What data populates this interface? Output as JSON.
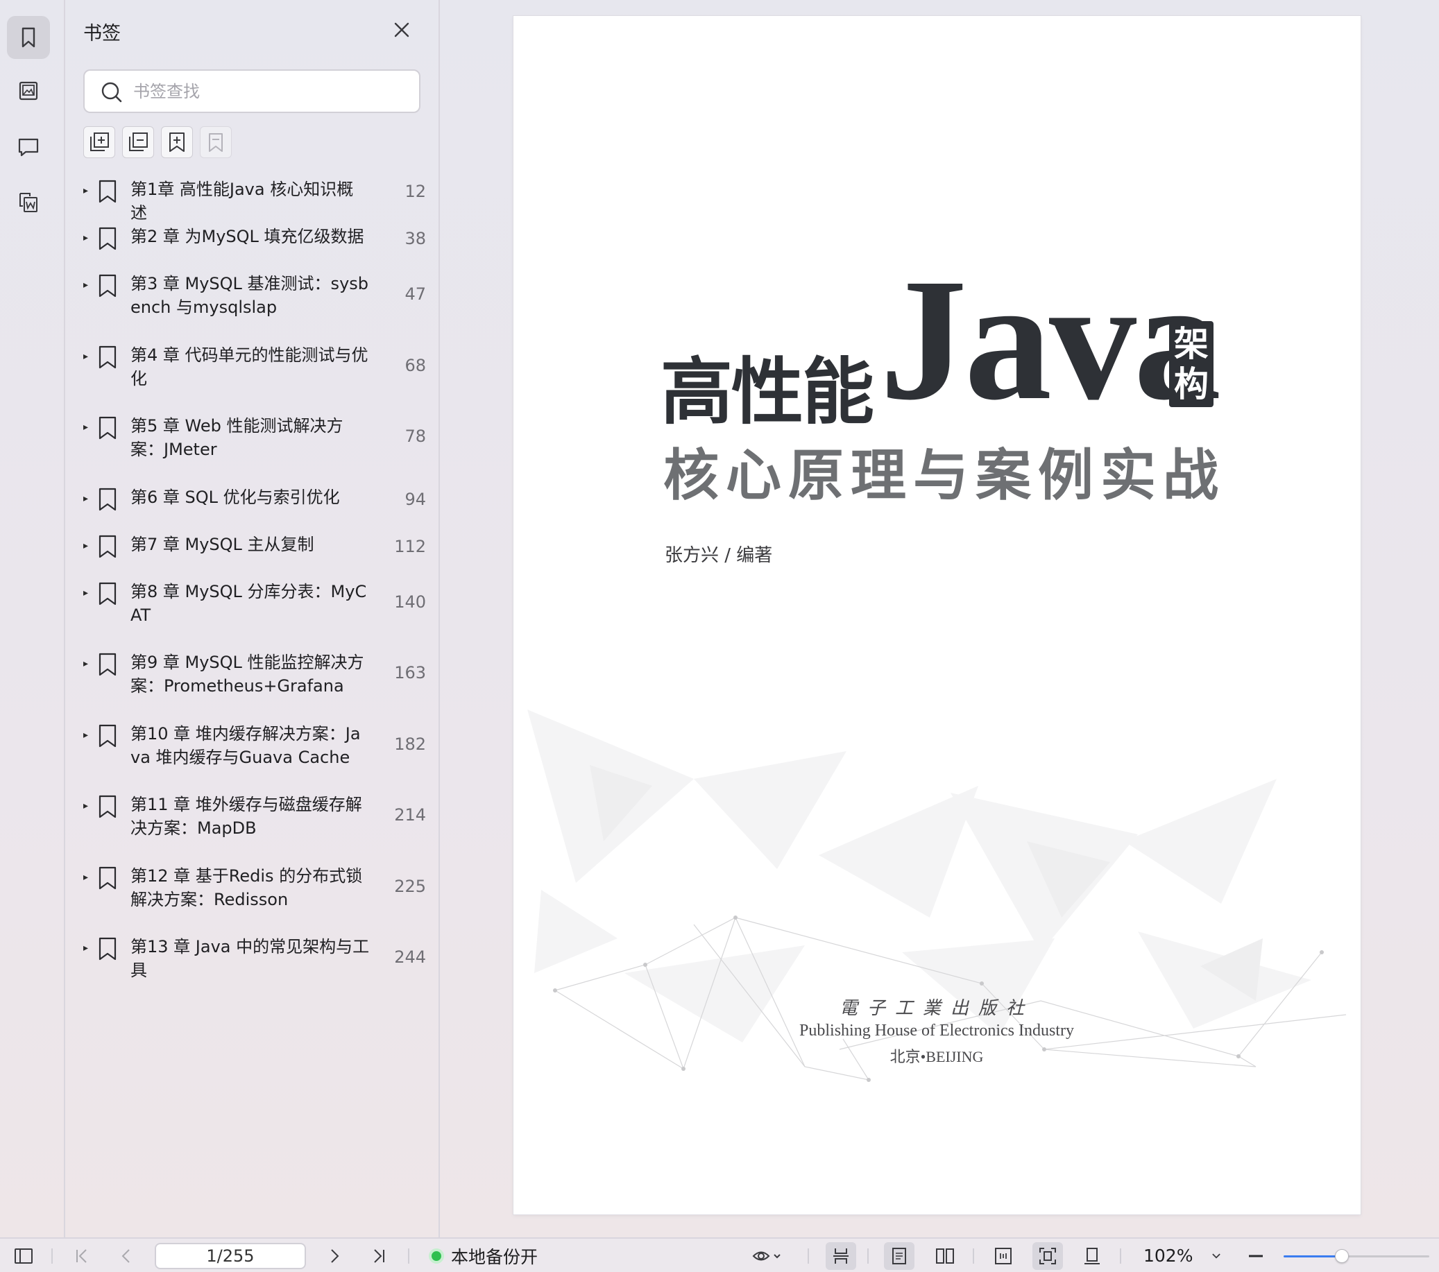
{
  "sidebar_rail": {
    "items": [
      {
        "icon": "bookmark-icon",
        "active": true
      },
      {
        "icon": "image-icon",
        "active": false
      },
      {
        "icon": "comment-icon",
        "active": false
      },
      {
        "icon": "convert-doc-icon",
        "active": false
      }
    ]
  },
  "bookmarks_panel": {
    "title": "书签",
    "search_placeholder": "书签查找",
    "search_value": "",
    "toolbar": [
      "expand-all-icon",
      "collapse-all-icon",
      "add-bookmark-icon",
      "bookmark-disabled-icon"
    ],
    "items": [
      {
        "label": "第1章 高性能Java 核心知识概述",
        "page": "12"
      },
      {
        "label": "第2 章 为MySQL 填充亿级数据",
        "page": "38"
      },
      {
        "label": "第3 章 MySQL 基准测试：sysbench 与mysqlslap",
        "page": "47"
      },
      {
        "label": "第4 章 代码单元的性能测试与优化",
        "page": "68"
      },
      {
        "label": "第5 章 Web 性能测试解决方案：JMeter",
        "page": "78"
      },
      {
        "label": "第6 章 SQL 优化与索引优化",
        "page": "94"
      },
      {
        "label": "第7 章 MySQL 主从复制",
        "page": "112"
      },
      {
        "label": "第8 章 MySQL 分库分表：MyCAT",
        "page": "140"
      },
      {
        "label": "第9 章 MySQL 性能监控解决方案：Prometheus+Grafana",
        "page": "163"
      },
      {
        "label": "第10 章 堆内缓存解决方案：Java 堆内缓存与Guava Cache",
        "page": "182"
      },
      {
        "label": "第11 章 堆外缓存与磁盘缓存解决方案：MapDB",
        "page": "214"
      },
      {
        "label": "第12 章 基于Redis 的分布式锁解决方案：Redisson",
        "page": "225"
      },
      {
        "label": "第13 章 Java 中的常见架构与工具",
        "page": "244"
      }
    ]
  },
  "cover": {
    "title_cn": "高性能",
    "title_java": "Java",
    "title_badge": [
      "架",
      "构"
    ],
    "subtitle": "核心原理与案例实战",
    "author": "张方兴 / 编著",
    "publisher_seal": "電子工業出版社",
    "publisher_en": "Publishing House of Electronics Industry",
    "publisher_city": "北京•BEIJING"
  },
  "statusbar": {
    "page_value": "1/255",
    "backup_label": "本地备份开",
    "zoom": "102%",
    "zoom_level": 0.4,
    "colors": {
      "backup_dot": "#2fbf4f",
      "slider": "#3b7cf0"
    }
  }
}
